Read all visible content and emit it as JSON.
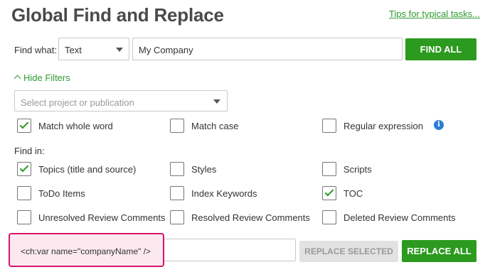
{
  "header": {
    "title": "Global Find and Replace",
    "tips_link": "Tips for typical tasks..."
  },
  "find": {
    "label": "Find what:",
    "type_value": "Text",
    "query_value": "My Company",
    "find_all_label": "FIND ALL"
  },
  "filters": {
    "toggle_label": "Hide Filters",
    "project_placeholder": "Select project or publication"
  },
  "match_options": [
    {
      "label": "Match whole word",
      "checked": true
    },
    {
      "label": "Match case",
      "checked": false
    },
    {
      "label": "Regular expression",
      "checked": false,
      "info_icon": "i"
    }
  ],
  "find_in": {
    "label": "Find in:",
    "options": [
      {
        "label": "Topics (title and source)",
        "checked": true
      },
      {
        "label": "Styles",
        "checked": false
      },
      {
        "label": "Scripts",
        "checked": false
      },
      {
        "label": "ToDo Items",
        "checked": false
      },
      {
        "label": "Index Keywords",
        "checked": false
      },
      {
        "label": "TOC",
        "checked": true
      },
      {
        "label": "Unresolved Review Comments",
        "checked": false
      },
      {
        "label": "Resolved Review Comments",
        "checked": false
      },
      {
        "label": "Deleted Review Comments",
        "checked": false
      }
    ]
  },
  "replace": {
    "value": "<ch:var name=\"companyName\" />",
    "replace_selected_label": "REPLACE SELECTED",
    "replace_all_label": "REPLACE ALL"
  },
  "colors": {
    "accent_green": "#2b9a1e",
    "highlight_border": "#d6156b",
    "info_blue": "#2a7fd4"
  }
}
